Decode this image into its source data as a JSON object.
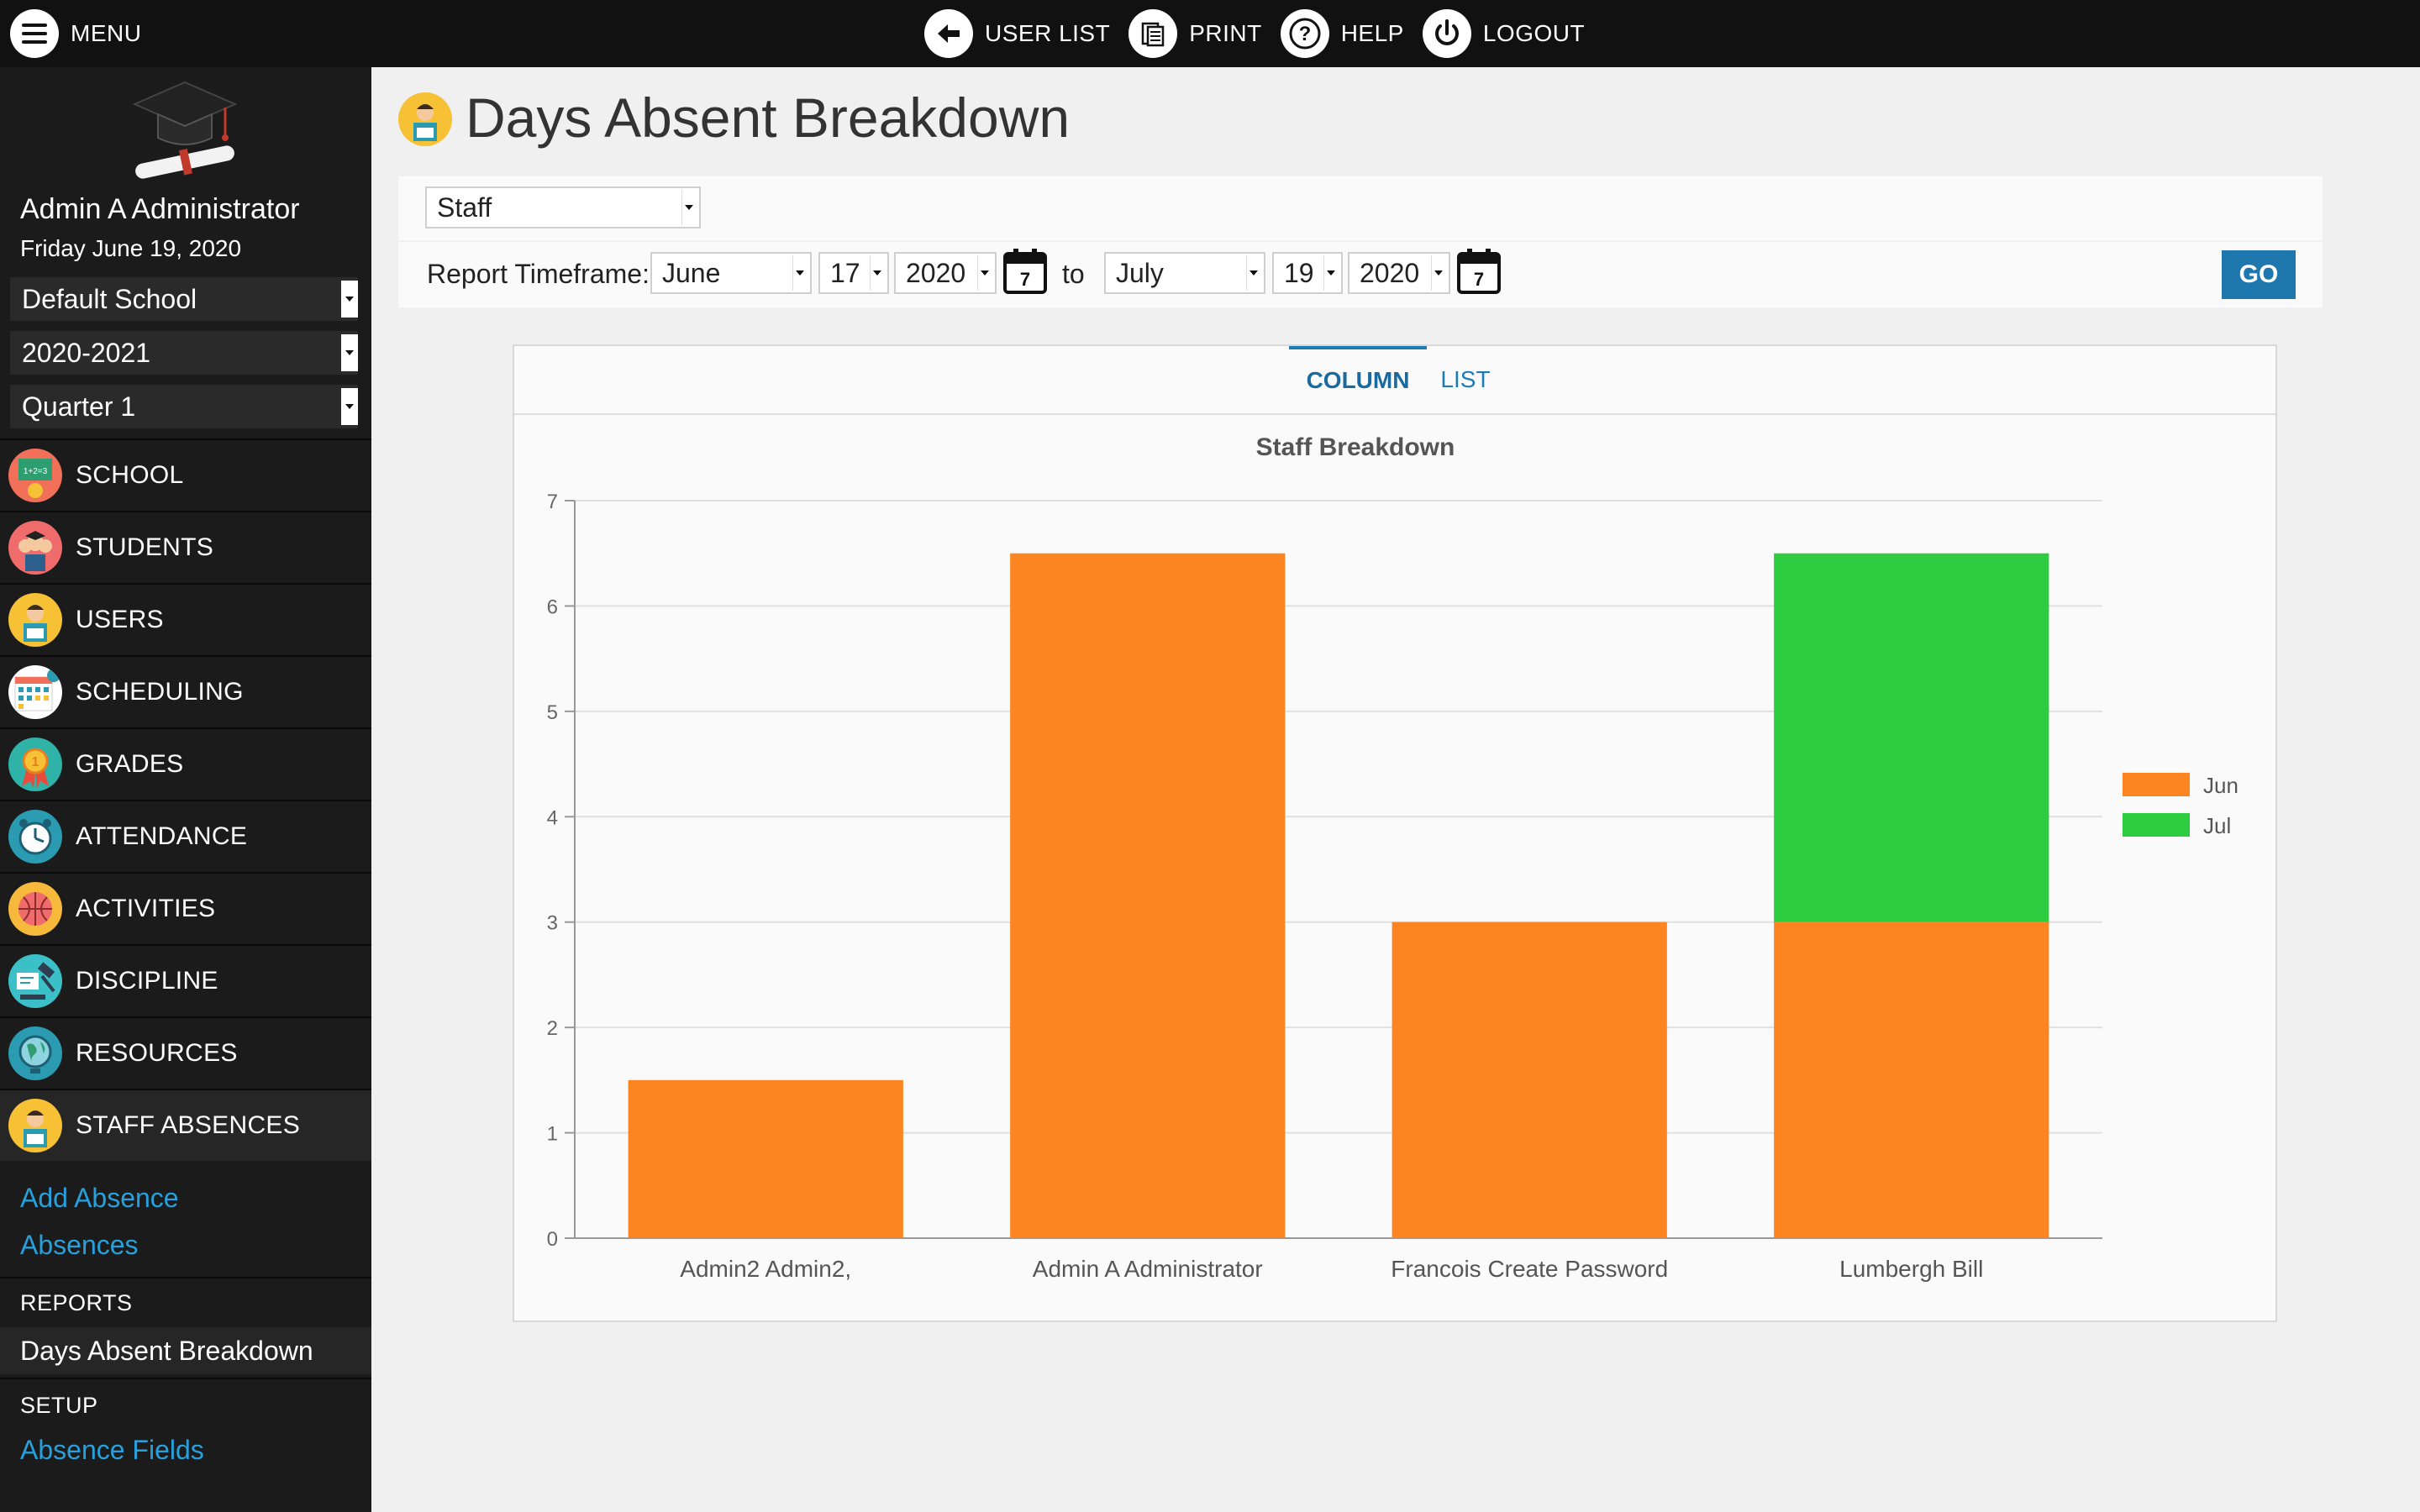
{
  "topbar": {
    "menu_label": "MENU",
    "nav": [
      {
        "label": "USER LIST",
        "icon": "arrow-left-icon"
      },
      {
        "label": "PRINT",
        "icon": "print-icon"
      },
      {
        "label": "HELP",
        "icon": "help-icon"
      },
      {
        "label": "LOGOUT",
        "icon": "power-icon"
      }
    ]
  },
  "sidebar": {
    "user_name": "Admin A Administrator",
    "date": "Friday June 19, 2020",
    "school_select": "Default School",
    "year_select": "2020-2021",
    "term_select": "Quarter 1",
    "nav": [
      {
        "label": "SCHOOL",
        "icon": "school-icon",
        "color": "#f0705a"
      },
      {
        "label": "STUDENTS",
        "icon": "students-icon",
        "color": "#f06b6b"
      },
      {
        "label": "USERS",
        "icon": "users-icon",
        "color": "#f6c135"
      },
      {
        "label": "SCHEDULING",
        "icon": "calendar-icon",
        "color": "#ffffff"
      },
      {
        "label": "GRADES",
        "icon": "medal-icon",
        "color": "#2fb3a8"
      },
      {
        "label": "ATTENDANCE",
        "icon": "clock-icon",
        "color": "#2a9bb0"
      },
      {
        "label": "ACTIVITIES",
        "icon": "basketball-icon",
        "color": "#f6b93b"
      },
      {
        "label": "DISCIPLINE",
        "icon": "gavel-icon",
        "color": "#3cc0c8"
      },
      {
        "label": "RESOURCES",
        "icon": "globe-icon",
        "color": "#2a9bb0"
      },
      {
        "label": "STAFF ABSENCES",
        "icon": "staff-icon",
        "color": "#f6c135"
      }
    ],
    "sub": {
      "add_absence": "Add Absence",
      "absences": "Absences",
      "reports_head": "REPORTS",
      "report_active": "Days Absent Breakdown",
      "setup_head": "SETUP",
      "absence_fields": "Absence Fields"
    }
  },
  "main": {
    "title": "Days Absent Breakdown",
    "type_select": "Staff",
    "timeframe_label": "Report Timeframe:",
    "from": {
      "month": "June",
      "day": "17",
      "year": "2020"
    },
    "to_label": "to",
    "to": {
      "month": "July",
      "day": "19",
      "year": "2020"
    },
    "calendar_day": "7",
    "go_label": "GO",
    "tabs": [
      "COLUMN",
      "LIST"
    ]
  },
  "chart_data": {
    "type": "bar",
    "stacked": true,
    "title": "Staff Breakdown",
    "categories": [
      "Admin2 Admin2,",
      "Admin A Administrator",
      "Francois Create Password",
      "Lumbergh Bill"
    ],
    "series": [
      {
        "name": "Jun",
        "color": "#fd8521",
        "values": [
          1.5,
          6.5,
          3,
          3
        ]
      },
      {
        "name": "Jul",
        "color": "#2ecc40",
        "values": [
          0,
          0,
          0,
          3.5
        ]
      }
    ],
    "ylim": [
      0,
      7
    ],
    "yticks": [
      0,
      1,
      2,
      3,
      4,
      5,
      6,
      7
    ],
    "grid": true,
    "legend_position": "right"
  }
}
